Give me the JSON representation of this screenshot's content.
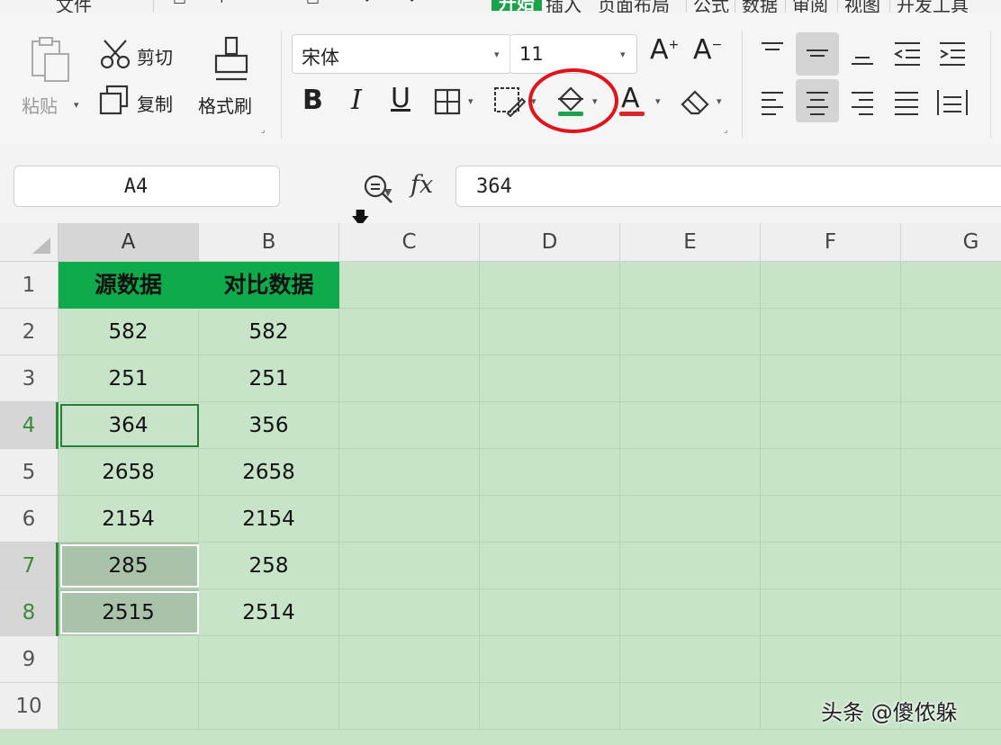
{
  "tabs": {
    "file": "文件",
    "active": "开始",
    "items": [
      "插入",
      "页面布局",
      "公式",
      "数据",
      "审阅",
      "视图",
      "开发工具"
    ]
  },
  "clipboard": {
    "paste_label": "粘贴",
    "cut_label": "剪切",
    "copy_label": "复制",
    "format_painter_label": "格式刷"
  },
  "font": {
    "name": "宋体",
    "size": "11",
    "bold": "B",
    "italic": "I",
    "underline": "U",
    "fill_color": "#1aa34a",
    "font_color": "#d9262c"
  },
  "formula_bar": {
    "cell_ref": "A4",
    "fx": "fx",
    "value": "364"
  },
  "sheet": {
    "columns": [
      "A",
      "B",
      "C",
      "D",
      "E",
      "F",
      "G"
    ],
    "rows": [
      "1",
      "2",
      "3",
      "4",
      "5",
      "6",
      "7",
      "8",
      "9",
      "10"
    ],
    "headers": [
      "源数据",
      "对比数据"
    ],
    "data": [
      [
        "582",
        "582"
      ],
      [
        "251",
        "251"
      ],
      [
        "364",
        "356"
      ],
      [
        "2658",
        "2658"
      ],
      [
        "2154",
        "2154"
      ],
      [
        "285",
        "258"
      ],
      [
        "2515",
        "2514"
      ]
    ],
    "header_color": "#0eaa4b",
    "sheet_bg_color": "#c8e4c8",
    "highlight_color": "#aac2aa"
  },
  "watermark": "头条 @傻侬躲"
}
